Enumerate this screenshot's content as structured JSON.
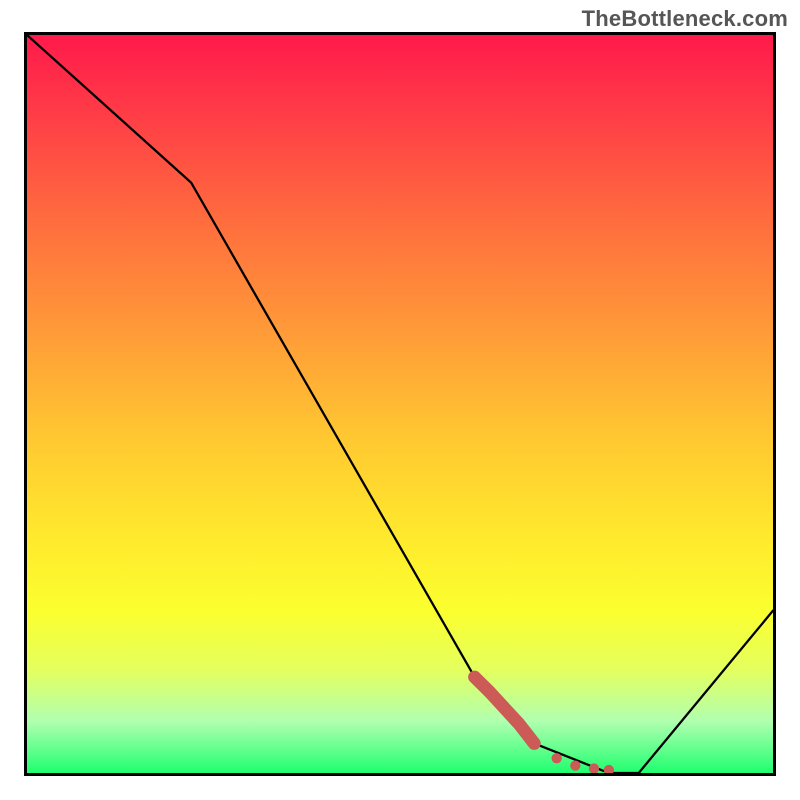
{
  "watermark": "TheBottleneck.com",
  "chart_data": {
    "type": "line",
    "title": "",
    "xlabel": "",
    "ylabel": "",
    "xlim": [
      0,
      100
    ],
    "ylim": [
      0,
      100
    ],
    "series": [
      {
        "name": "bottleneck-curve",
        "color": "#000000",
        "stroke_width": 2,
        "x": [
          0,
          22,
          60,
          68,
          78,
          82,
          100
        ],
        "y": [
          100,
          80,
          13,
          4,
          0,
          0,
          22
        ]
      },
      {
        "name": "highlight-marks",
        "color": "#cc5a57",
        "type": "scatter",
        "x": [
          60,
          62,
          64,
          66,
          68,
          71,
          73.5,
          76,
          78
        ],
        "y": [
          13.0,
          11.0,
          8.8,
          6.6,
          4.0,
          2.0,
          1.0,
          0.6,
          0.4
        ]
      }
    ],
    "background": {
      "gradient_stops": [
        {
          "pos": 0.0,
          "color": "#ff1a4b"
        },
        {
          "pos": 0.25,
          "color": "#ff6c3e"
        },
        {
          "pos": 0.55,
          "color": "#ffc931"
        },
        {
          "pos": 0.78,
          "color": "#fbff2e"
        },
        {
          "pos": 1.0,
          "color": "#1fff6f"
        }
      ]
    }
  }
}
